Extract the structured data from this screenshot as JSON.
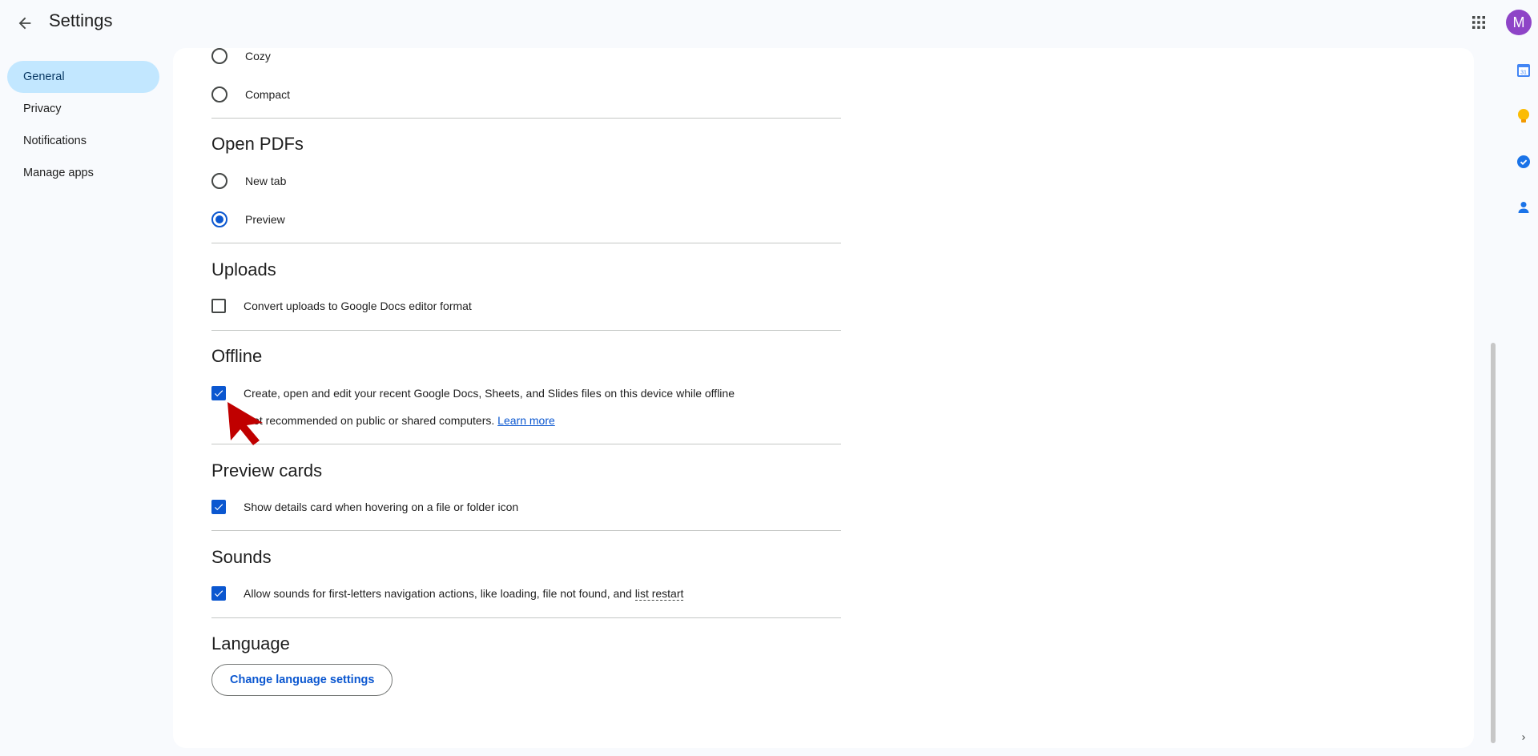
{
  "header": {
    "title": "Settings",
    "avatar_letter": "M"
  },
  "nav": {
    "items": [
      {
        "label": "General"
      },
      {
        "label": "Privacy"
      },
      {
        "label": "Notifications"
      },
      {
        "label": "Manage apps"
      }
    ]
  },
  "density": {
    "options": [
      {
        "label": "Cozy",
        "checked": false
      },
      {
        "label": "Compact",
        "checked": false
      }
    ]
  },
  "open_pdfs": {
    "title": "Open PDFs",
    "options": [
      {
        "label": "New tab",
        "checked": false
      },
      {
        "label": "Preview",
        "checked": true
      }
    ]
  },
  "uploads": {
    "title": "Uploads",
    "checkbox_label": "Convert uploads to Google Docs editor format",
    "checked": false
  },
  "offline": {
    "title": "Offline",
    "checkbox_label": "Create, open and edit your recent Google Docs, Sheets, and Slides files on this device while offline",
    "checked": true,
    "note": "Not recommended on public or shared computers.",
    "link": "Learn more"
  },
  "preview_cards": {
    "title": "Preview cards",
    "checkbox_label": "Show details card when hovering on a file or folder icon",
    "checked": true
  },
  "sounds": {
    "title": "Sounds",
    "checkbox_label_prefix": "Allow sounds for first-letters navigation actions, like loading, file not found, and ",
    "checkbox_label_term": "list restart",
    "checked": true
  },
  "language": {
    "title": "Language",
    "button_label": "Change language settings"
  },
  "side_panel": {
    "calendar_day": "31"
  },
  "colors": {
    "accent": "#0b57d0",
    "nav_active_bg": "#c2e7ff",
    "avatar_bg": "#8e44c7",
    "cursor": "#c00000"
  }
}
